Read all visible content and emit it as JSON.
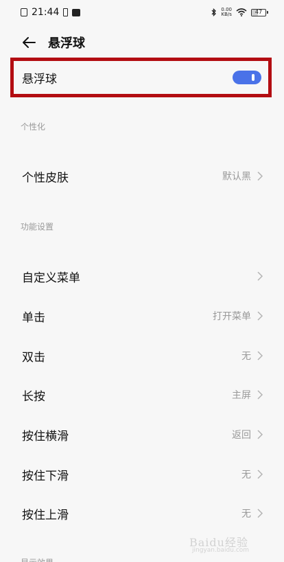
{
  "status_bar": {
    "time": "21:44",
    "net_speed_value": "0.00",
    "net_speed_unit": "KB/s",
    "battery": "47",
    "battery_level_percent": 47,
    "icons": [
      "photo-icon",
      "sim-icon",
      "mail-icon",
      "bluetooth-icon",
      "wifi-icon",
      "battery-icon"
    ]
  },
  "header": {
    "title": "悬浮球"
  },
  "float_ball": {
    "label": "悬浮球",
    "enabled": true,
    "toggle_color": "#4a72e8",
    "highlight_color": "#b30d12"
  },
  "sections": {
    "personalize": {
      "title": "个性化",
      "skin": {
        "label": "个性皮肤",
        "value": "默认黑"
      }
    },
    "functions": {
      "title": "功能设置",
      "custom_menu": {
        "label": "自定义菜单",
        "value": ""
      },
      "single_tap": {
        "label": "单击",
        "value": "打开菜单"
      },
      "double_tap": {
        "label": "双击",
        "value": "无"
      },
      "long_press": {
        "label": "长按",
        "value": "主屏"
      },
      "hold_swipe_horizontal": {
        "label": "按住横滑",
        "value": "返回"
      },
      "hold_swipe_down": {
        "label": "按住下滑",
        "value": "无"
      },
      "hold_swipe_up": {
        "label": "按住上滑",
        "value": "无"
      }
    },
    "display": {
      "title": "显示效果"
    }
  },
  "watermark": {
    "text": "Baidu经验",
    "sub": "jingyan.baidu.com"
  }
}
